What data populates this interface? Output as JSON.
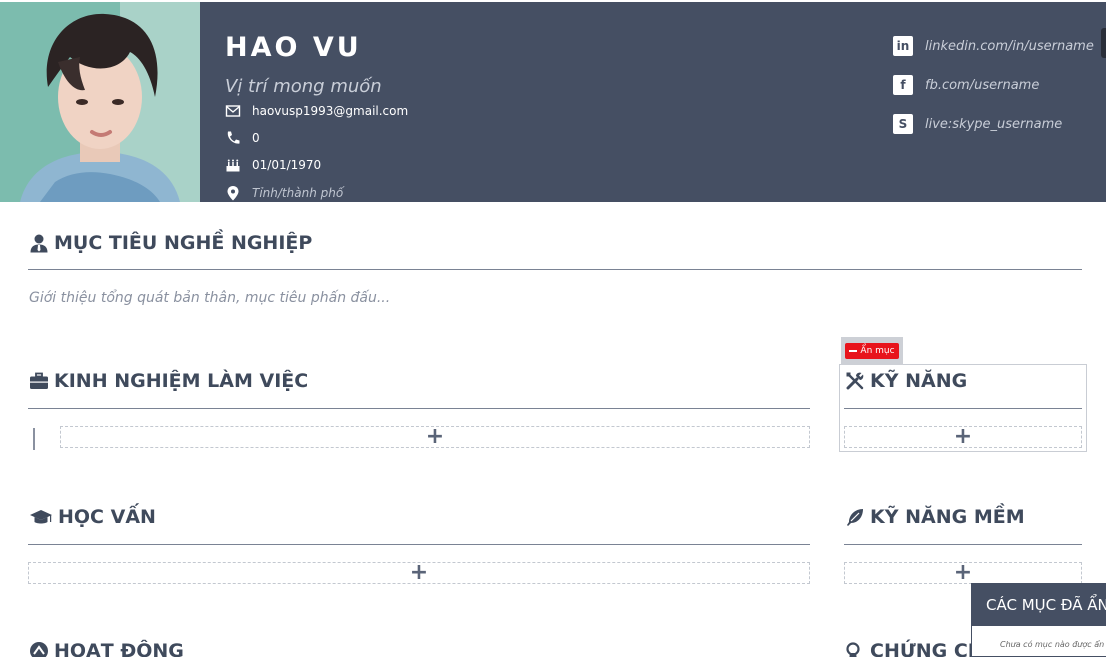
{
  "profile": {
    "name": "HAO VU",
    "position_placeholder": "Vị trí mong muốn",
    "email": "haovusp1993@gmail.com",
    "phone": "0",
    "birthday": "01/01/1970",
    "location_placeholder": "Tỉnh/thành phố"
  },
  "social": {
    "linkedin": "linkedin.com/in/username",
    "facebook": "fb.com/username",
    "skype": "live:skype_username"
  },
  "sections": {
    "objective": {
      "title": "MỤC TIÊU NGHỀ NGHIỆP",
      "placeholder": "Giới thiệu tổng quát bản thân, mục tiêu phấn đấu..."
    },
    "experience": {
      "title": "KINH NGHIỆM LÀM VIỆC"
    },
    "skills": {
      "title": "KỸ NĂNG",
      "hide_label": "Ẩn mục"
    },
    "education": {
      "title": "HỌC VẤN"
    },
    "soft_skills": {
      "title": "KỸ NĂNG MỀM"
    },
    "activities": {
      "title": "HOẠT ĐỘNG"
    },
    "certificates": {
      "title": "CHỨNG CHỈ"
    }
  },
  "add_symbol": "+",
  "hidden_panel": {
    "title": "CÁC MỤC ĐÃ ẨN",
    "empty_text": "Chưa có mục nào được ẩn"
  },
  "colors": {
    "header_bg": "#454f63",
    "hide_button": "#e8141c"
  }
}
